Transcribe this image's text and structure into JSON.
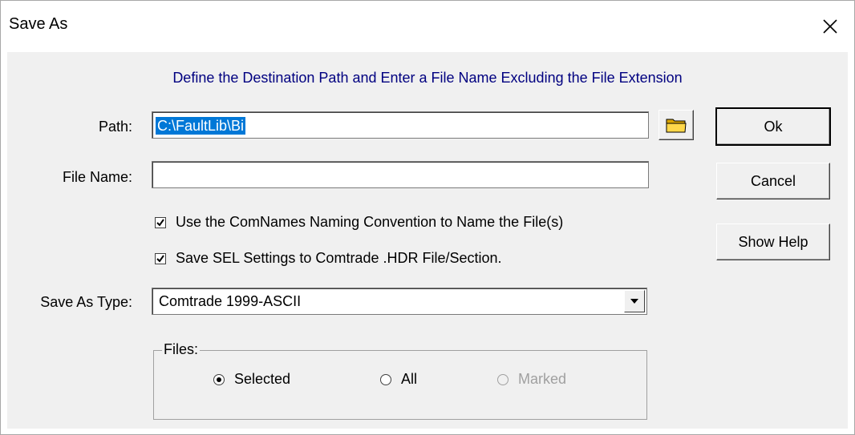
{
  "window": {
    "title": "Save As"
  },
  "instruction": "Define the Destination Path and Enter a File Name Excluding the File Extension",
  "path": {
    "label": "Path:",
    "value": "C:\\FaultLib\\Bi"
  },
  "filename": {
    "label": "File Name:",
    "value": ""
  },
  "checkboxes": [
    {
      "label": "Use the ComNames Naming Convention to Name the File(s)",
      "checked": true
    },
    {
      "label": "Save SEL Settings to Comtrade .HDR File/Section.",
      "checked": true
    }
  ],
  "save_as_type": {
    "label": "Save As Type:",
    "value": "Comtrade 1999-ASCII"
  },
  "files_group": {
    "title": "Files:",
    "options": [
      {
        "label": "Selected",
        "selected": true,
        "enabled": true
      },
      {
        "label": "All",
        "selected": false,
        "enabled": true
      },
      {
        "label": "Marked",
        "selected": false,
        "enabled": false
      }
    ]
  },
  "buttons": {
    "ok": "Ok",
    "cancel": "Cancel",
    "help": "Show Help"
  },
  "icons": {
    "close": "close-icon",
    "folder": "folder-icon",
    "dropdown": "dropdown-arrow-icon"
  },
  "colors": {
    "instruction": "#000080",
    "selection": "#0078d7",
    "dialog_bg": "#f0f0f0"
  }
}
